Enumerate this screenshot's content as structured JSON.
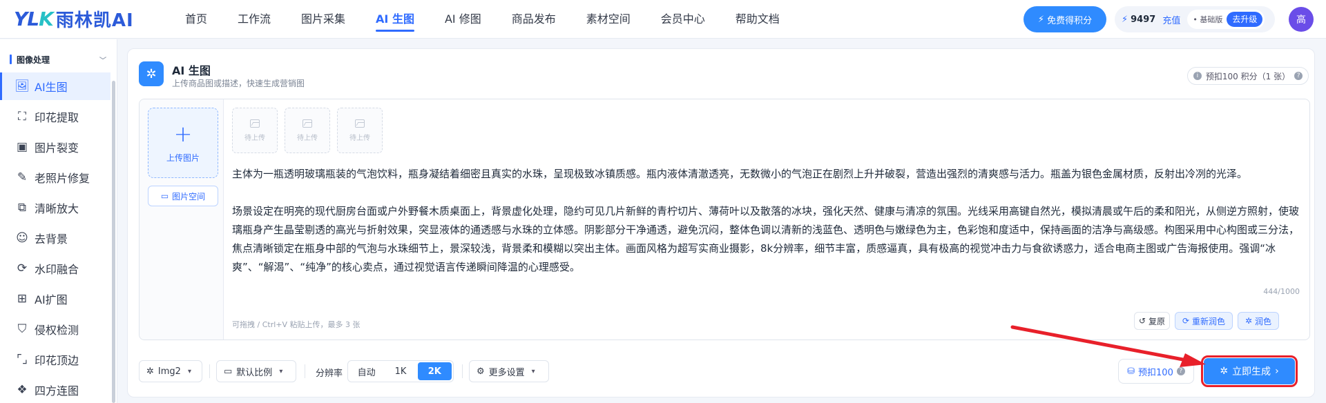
{
  "header": {
    "logo_mark": "YLK",
    "logo_text": "雨林凯AI",
    "nav": [
      "首页",
      "工作流",
      "图片采集",
      "AI 生图",
      "AI 修图",
      "商品发布",
      "素材空间",
      "会员中心",
      "帮助文档"
    ],
    "active_nav_index": 3,
    "free_points_label": "免费得积分",
    "points_value": "9497",
    "recharge_label": "充值",
    "plan_label": "基础版",
    "upgrade_label": "去升级",
    "avatar_text": "高"
  },
  "sidebar": {
    "group_title": "图像处理",
    "items": [
      "AI生图",
      "印花提取",
      "图片裂变",
      "老照片修复",
      "清晰放大",
      "去背景",
      "水印融合",
      "AI扩图",
      "侵权检测",
      "印花顶边",
      "四方连图"
    ],
    "active_index": 0
  },
  "card": {
    "title": "AI 生图",
    "subtitle": "上传商品图或描述，快速生成营销图",
    "cost_label": "预扣100 积分（1 张）",
    "upload_label": "上传图片",
    "space_label": "图片空间",
    "thumb_label": "待上传",
    "prompt_p1": "主体为一瓶透明玻璃瓶装的气泡饮料，瓶身凝结着细密且真实的水珠，呈现极致冰镇质感。瓶内液体清澈透亮，无数微小的气泡正在剧烈上升并破裂，营造出强烈的清爽感与活力。瓶盖为银色金属材质，反射出冷冽的光泽。",
    "prompt_p2": "场景设定在明亮的现代厨房台面或户外野餐木质桌面上，背景虚化处理，隐约可见几片新鲜的青柠切片、薄荷叶以及散落的冰块，强化天然、健康与清凉的氛围。光线采用高键自然光，模拟清晨或午后的柔和阳光，从侧逆方照射，使玻璃瓶身产生晶莹剔透的高光与折射效果，突显液体的通透感与水珠的立体感。阴影部分干净通透，避免沉闷，整体色调以清新的浅蓝色、透明色与嫩绿色为主，色彩饱和度适中，保持画面的洁净与高级感。构图采用中心构图或三分法，焦点清晰锁定在瓶身中部的气泡与水珠细节上，景深较浅，背景柔和模糊以突出主体。画面风格为超写实商业摄影，8k分辨率，细节丰富，质感逼真，具有极高的视觉冲击力与食欲诱惑力，适合电商主图或广告海报使用。强调“冰爽”、“解渴”、“纯净”的核心卖点，通过视觉语言传递瞬间降温的心理感受。",
    "counter": "444/1000",
    "hint": "可拖拽 / Ctrl+V 粘贴上传，最多 3 张",
    "restore_label": "复原",
    "repolish_label": "重新润色",
    "polish_label": "润色"
  },
  "toolbar": {
    "model_label": "Img2",
    "ratio_label": "默认比例",
    "resolution_label": "分辨率",
    "resolution_options": [
      "自动",
      "1K",
      "2K"
    ],
    "resolution_selected": 2,
    "more_settings_label": "更多设置",
    "deduct_label": "预扣100",
    "generate_label": "立即生成"
  },
  "colors": {
    "accent": "#2f6bff",
    "button_blue": "#2f8bff",
    "annotation_red": "#e8202a"
  }
}
